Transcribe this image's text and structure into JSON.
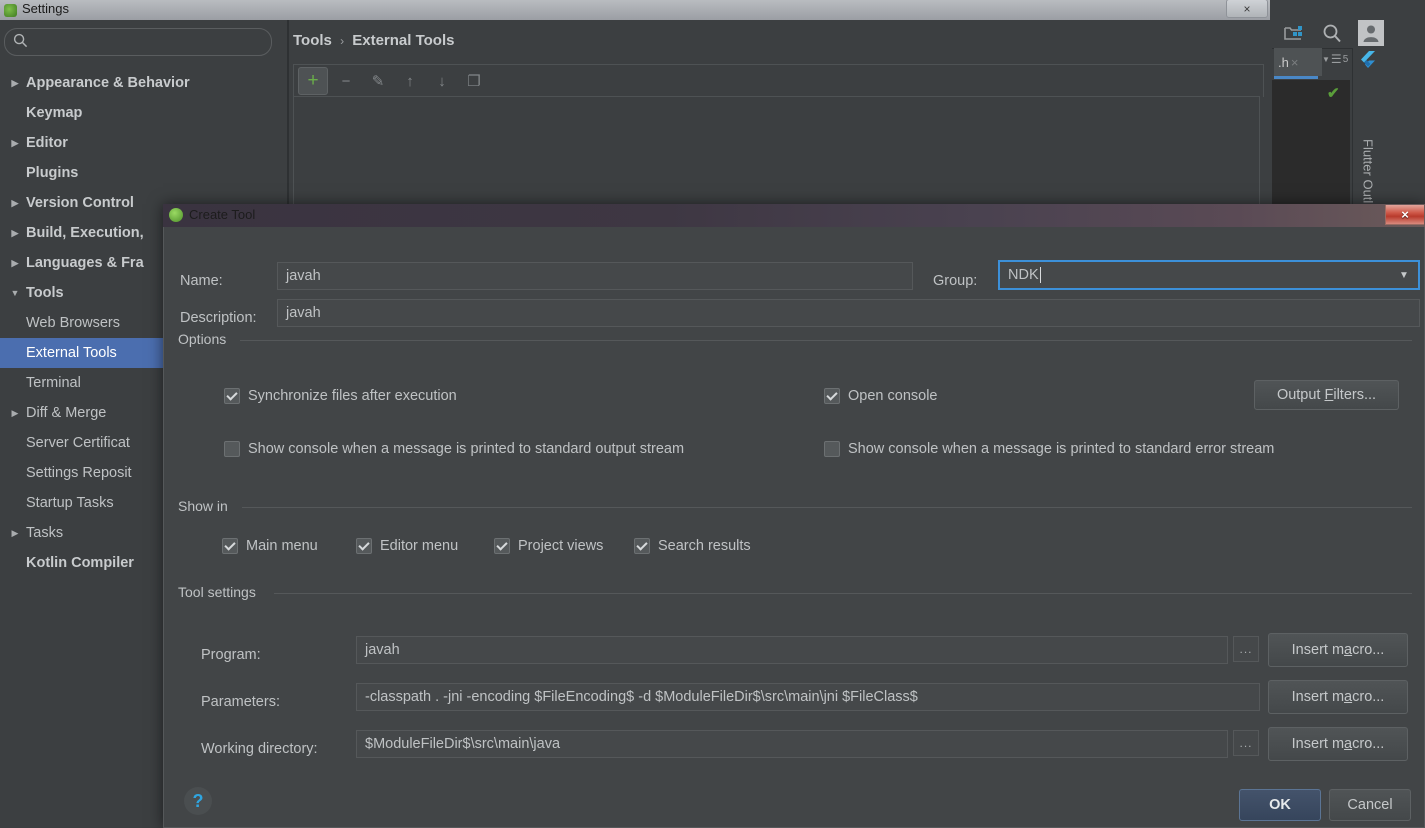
{
  "ide": {
    "tab_label": ".h",
    "tab_close": "×",
    "view_count": "5",
    "right_panel_label": "Flutter Outline",
    "icons": {
      "project_structure": "project-structure-icon",
      "search": "search-icon",
      "avatar": "avatar-icon",
      "flutter": "flutter-logo-icon",
      "inspection": "inspection-check-icon"
    }
  },
  "settings": {
    "window_title": "Settings",
    "close_label": "×",
    "search": {
      "value": "",
      "placeholder": ""
    },
    "tree": [
      {
        "label": "Appearance & Behavior",
        "arrow": "▶",
        "bold": true,
        "indent": 1,
        "selected": false
      },
      {
        "label": "Keymap",
        "arrow": "",
        "bold": true,
        "indent": 2,
        "selected": false
      },
      {
        "label": "Editor",
        "arrow": "▶",
        "bold": true,
        "indent": 1,
        "selected": false
      },
      {
        "label": "Plugins",
        "arrow": "",
        "bold": true,
        "indent": 2,
        "selected": false
      },
      {
        "label": "Version Control",
        "arrow": "▶",
        "bold": true,
        "indent": 1,
        "selected": false
      },
      {
        "label": "Build, Execution,",
        "arrow": "▶",
        "bold": true,
        "indent": 1,
        "selected": false
      },
      {
        "label": "Languages & Fra",
        "arrow": "▶",
        "bold": true,
        "indent": 1,
        "selected": false
      },
      {
        "label": "Tools",
        "arrow": "▼",
        "bold": true,
        "indent": 1,
        "selected": false
      },
      {
        "label": "Web Browsers",
        "arrow": "",
        "bold": false,
        "indent": 2,
        "selected": false
      },
      {
        "label": "External Tools",
        "arrow": "",
        "bold": false,
        "indent": 2,
        "selected": true
      },
      {
        "label": "Terminal",
        "arrow": "",
        "bold": false,
        "indent": 2,
        "selected": false
      },
      {
        "label": "Diff & Merge",
        "arrow": "▶",
        "bold": false,
        "indent": 1,
        "selected": false
      },
      {
        "label": "Server Certificat",
        "arrow": "",
        "bold": false,
        "indent": 2,
        "selected": false
      },
      {
        "label": "Settings Reposit",
        "arrow": "",
        "bold": false,
        "indent": 2,
        "selected": false
      },
      {
        "label": "Startup Tasks",
        "arrow": "",
        "bold": false,
        "indent": 2,
        "selected": false
      },
      {
        "label": "Tasks",
        "arrow": "▶",
        "bold": false,
        "indent": 1,
        "selected": false
      },
      {
        "label": "Kotlin Compiler",
        "arrow": "",
        "bold": true,
        "indent": 2,
        "selected": false
      }
    ],
    "breadcrumb": {
      "parent": "Tools",
      "separator": "›",
      "current": "External Tools"
    },
    "toolbar": [
      {
        "name": "add-tool-button",
        "glyph": "+",
        "active": true
      },
      {
        "name": "remove-tool-button",
        "glyph": "−",
        "active": false
      },
      {
        "name": "edit-tool-button",
        "glyph": "✎",
        "active": false
      },
      {
        "name": "move-up-button",
        "glyph": "↑",
        "active": false
      },
      {
        "name": "move-down-button",
        "glyph": "↓",
        "active": false
      },
      {
        "name": "copy-tool-button",
        "glyph": "❐",
        "active": false
      }
    ]
  },
  "dialog": {
    "title": "Create Tool",
    "close_label": "×",
    "name": {
      "label": "Name:",
      "value": "javah"
    },
    "group": {
      "label": "Group:",
      "value": "NDK"
    },
    "description": {
      "label": "Description:",
      "value": "javah"
    },
    "options": {
      "title": "Options",
      "checkboxes": [
        {
          "label": "Synchronize files after execution",
          "checked": true
        },
        {
          "label": "Open console",
          "checked": true
        },
        {
          "label": "Show console when a message is printed to standard output stream",
          "checked": false
        },
        {
          "label": "Show console when a message is printed to standard error stream",
          "checked": false
        }
      ],
      "output_filters_button": {
        "pre": "Output ",
        "accel": "F",
        "post": "ilters..."
      }
    },
    "show_in": {
      "title": "Show in",
      "checkboxes": [
        {
          "label": "Main menu",
          "checked": true
        },
        {
          "label": "Editor menu",
          "checked": true
        },
        {
          "label": "Project views",
          "checked": true
        },
        {
          "label": "Search results",
          "checked": true
        }
      ]
    },
    "tool_settings": {
      "title": "Tool settings",
      "fields": [
        {
          "label": "Program:",
          "value": "javah",
          "browse": true,
          "browse_label": "..."
        },
        {
          "label": "Parameters:",
          "value": "-classpath . -jni -encoding $FileEncoding$ -d $ModuleFileDir$\\src\\main\\jni $FileClass$",
          "browse": false,
          "browse_label": ""
        },
        {
          "label": "Working directory:",
          "value": "$ModuleFileDir$\\src\\main\\java",
          "browse": true,
          "browse_label": "..."
        }
      ],
      "insert_macro_button": {
        "pre": "Insert m",
        "accel": "a",
        "post": "cro..."
      }
    },
    "help_label": "?",
    "ok_label": "OK",
    "cancel_label": "Cancel"
  }
}
